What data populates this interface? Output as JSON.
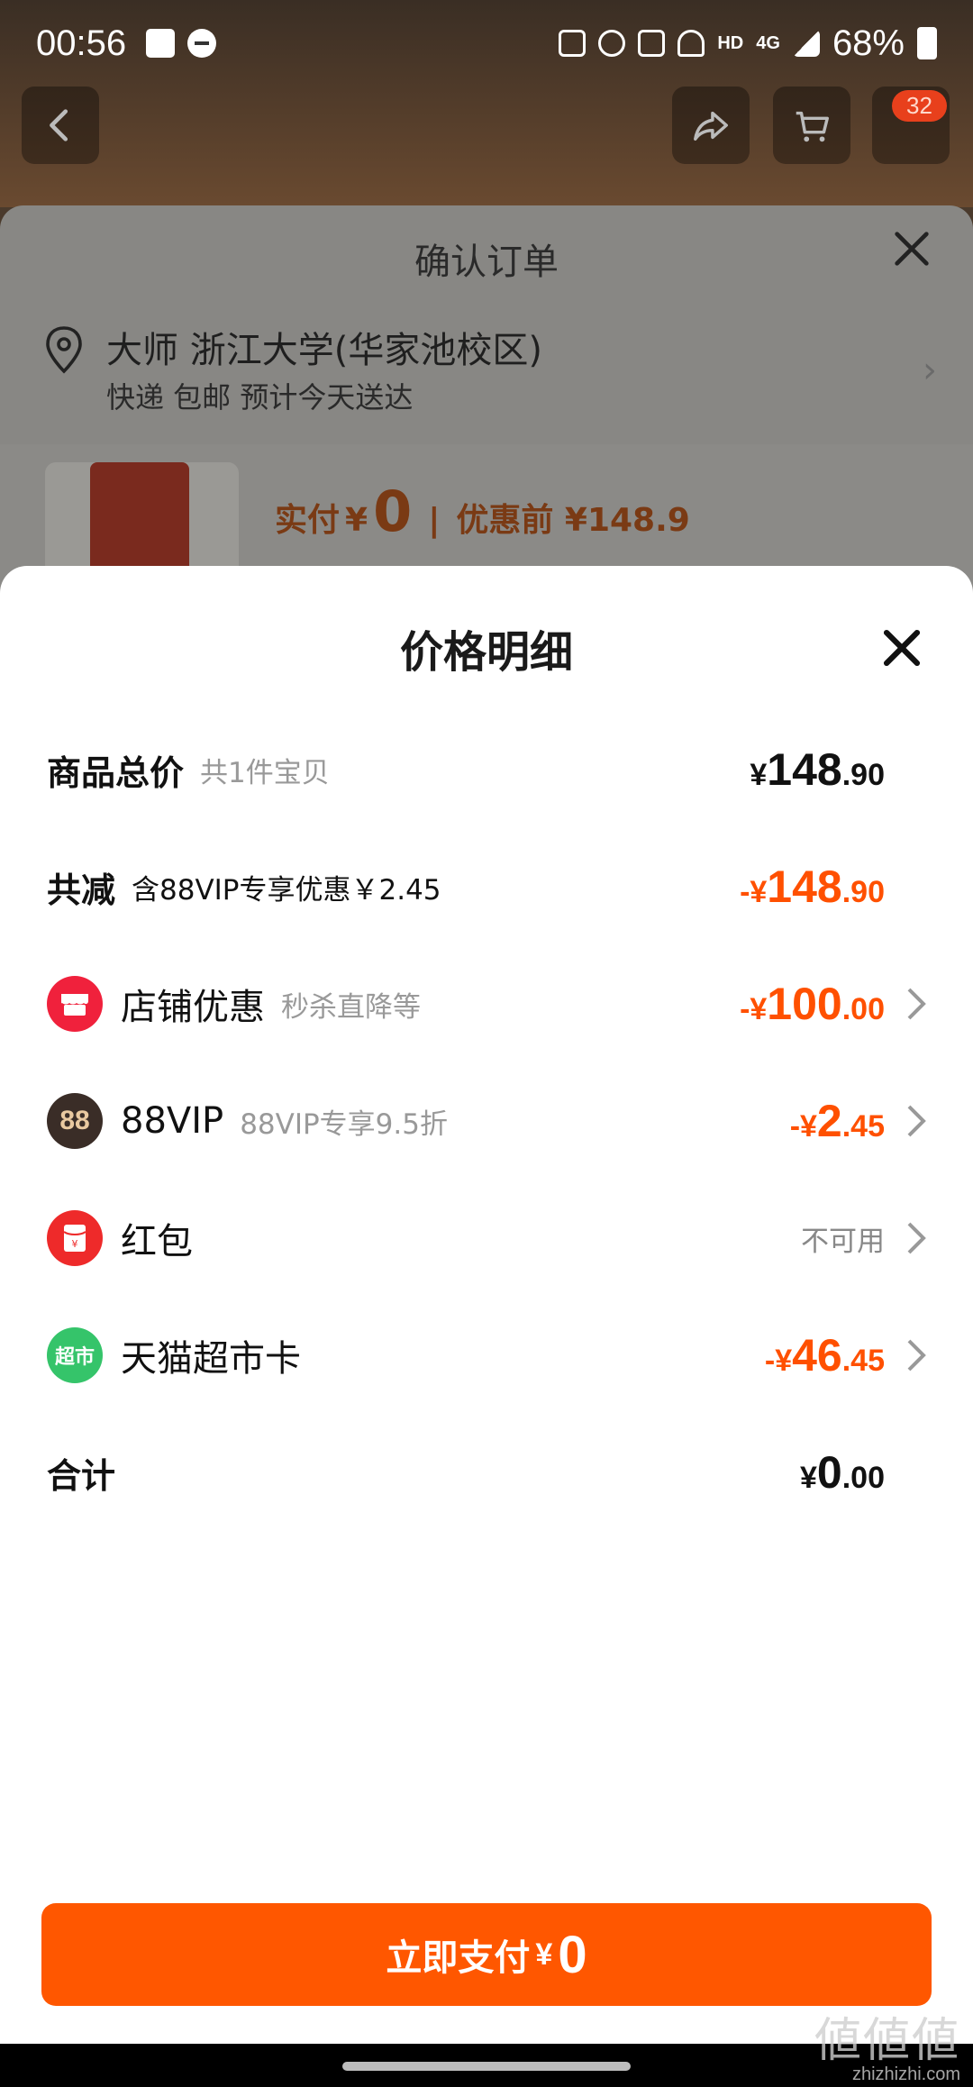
{
  "status_bar": {
    "time": "00:56",
    "battery": "68%",
    "net": "HD",
    "gen": "4G"
  },
  "background_page": {
    "cart_badge": "32"
  },
  "confirm_order": {
    "title": "确认订单",
    "address_name": "大师 浙江大学(华家池校区)",
    "address_sub": "快递 包邮 预计今天送达",
    "paid_label": "实付",
    "paid_currency": "¥",
    "paid_value": "0",
    "before_discount": "优惠前 ¥148.9"
  },
  "price_detail": {
    "title": "价格明细",
    "rows": [
      {
        "label": "商品总价",
        "sub": "共1件宝贝",
        "currency": "¥",
        "int": "148",
        "dec": ".90",
        "color": "black"
      },
      {
        "label": "共减",
        "sub": "含88VIP专享优惠￥2.45",
        "currency": "-¥",
        "int": "148",
        "dec": ".90",
        "color": "orange"
      },
      {
        "label": "店铺优惠",
        "sub": "秒杀直降等",
        "currency": "-¥",
        "int": "100",
        "dec": ".00",
        "color": "orange",
        "icon": "store-icon"
      },
      {
        "label": "88VIP",
        "sub": "88VIP专享9.5折",
        "currency": "-¥",
        "int": "2",
        "dec": ".45",
        "color": "orange",
        "icon": "vip-88-icon",
        "icon_text": "88"
      },
      {
        "label": "红包",
        "status": "不可用",
        "icon": "red-envelope-icon"
      },
      {
        "label": "天猫超市卡",
        "currency": "-¥",
        "int": "46",
        "dec": ".45",
        "color": "orange",
        "icon": "tmall-supermarket-icon",
        "icon_text": "超市"
      },
      {
        "label": "合计",
        "currency": "¥",
        "int": "0",
        "dec": ".00",
        "color": "black"
      }
    ]
  },
  "pay_button": {
    "label": "立即支付",
    "currency": "¥",
    "value": "0"
  },
  "watermark": {
    "glyphs": "値値値",
    "url": "zhizhizhi.com"
  },
  "colors": {
    "accent": "#ff5000",
    "button": "#ff5700"
  }
}
